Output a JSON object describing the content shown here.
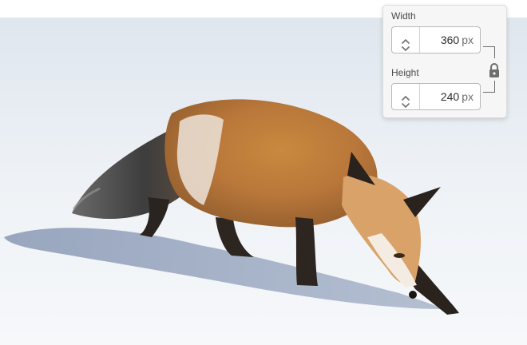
{
  "dimensions": {
    "width_label": "Width",
    "width_value": "360",
    "height_label": "Height",
    "height_value": "240",
    "unit": "px"
  },
  "icons": {
    "stepper": "stepper-icon",
    "lock": "lock-icon",
    "photo": "fox-in-snow-photo"
  },
  "colors": {
    "panel_bg": "#f6f6f6",
    "field_border": "#b9b9b9",
    "text": "#2c2c2c",
    "icon": "#6e6e6e"
  }
}
